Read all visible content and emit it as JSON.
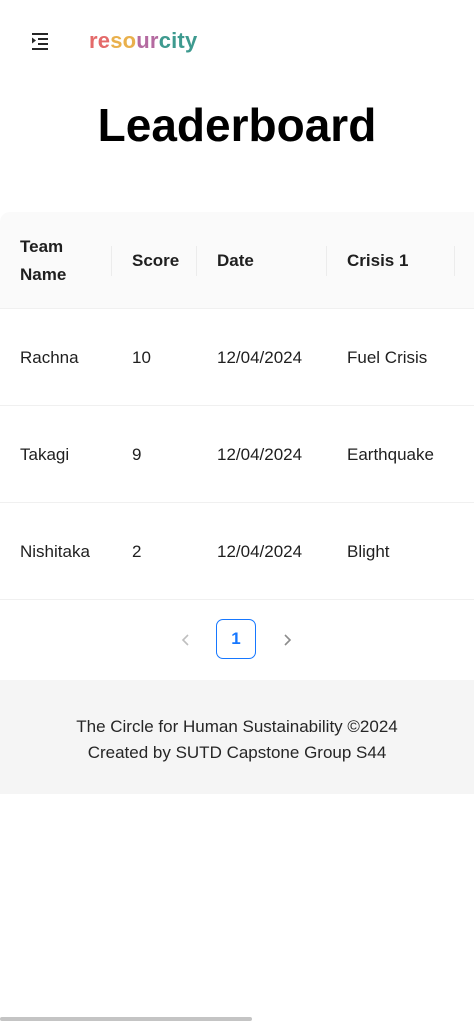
{
  "header": {
    "logo_parts": [
      {
        "text": "re",
        "color": "#e46a6a"
      },
      {
        "text": "so",
        "color": "#e9b04c"
      },
      {
        "text": "ur",
        "color": "#b46aa0"
      },
      {
        "text": "city",
        "color": "#3e9a8f"
      }
    ],
    "menu_icon": "menu-unfold-icon"
  },
  "page_title": "Leaderboard",
  "table": {
    "columns": [
      "Team Name",
      "Score",
      "Date",
      "Crisis 1"
    ],
    "rows": [
      [
        "Rachna",
        "10",
        "12/04/2024",
        "Fuel Crisis"
      ],
      [
        "Takagi",
        "9",
        "12/04/2024",
        "Earthquake"
      ],
      [
        "Nishitaka",
        "2",
        "12/04/2024",
        "Blight"
      ]
    ]
  },
  "pagination": {
    "current_page": "1",
    "prev_icon": "chevron-left-icon",
    "next_icon": "chevron-right-icon"
  },
  "footer": {
    "line1": "The Circle for Human Sustainability ©2024",
    "line2": "Created by SUTD Capstone Group S44"
  },
  "colors": {
    "accent": "#1677ff",
    "table_header_bg": "#fafafa",
    "footer_bg": "#f5f5f5"
  }
}
